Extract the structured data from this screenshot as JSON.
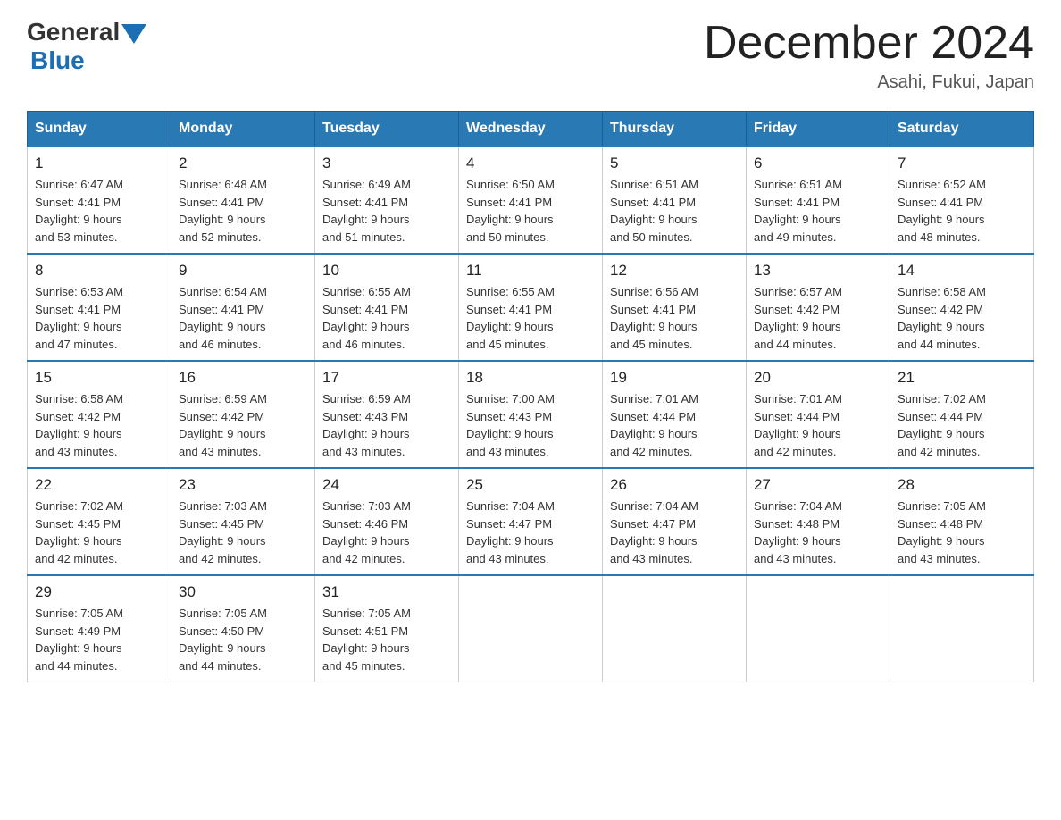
{
  "logo": {
    "general": "General",
    "blue": "Blue"
  },
  "title": "December 2024",
  "location": "Asahi, Fukui, Japan",
  "days_of_week": [
    "Sunday",
    "Monday",
    "Tuesday",
    "Wednesday",
    "Thursday",
    "Friday",
    "Saturday"
  ],
  "weeks": [
    [
      {
        "day": "1",
        "sunrise": "6:47 AM",
        "sunset": "4:41 PM",
        "daylight": "9 hours and 53 minutes."
      },
      {
        "day": "2",
        "sunrise": "6:48 AM",
        "sunset": "4:41 PM",
        "daylight": "9 hours and 52 minutes."
      },
      {
        "day": "3",
        "sunrise": "6:49 AM",
        "sunset": "4:41 PM",
        "daylight": "9 hours and 51 minutes."
      },
      {
        "day": "4",
        "sunrise": "6:50 AM",
        "sunset": "4:41 PM",
        "daylight": "9 hours and 50 minutes."
      },
      {
        "day": "5",
        "sunrise": "6:51 AM",
        "sunset": "4:41 PM",
        "daylight": "9 hours and 50 minutes."
      },
      {
        "day": "6",
        "sunrise": "6:51 AM",
        "sunset": "4:41 PM",
        "daylight": "9 hours and 49 minutes."
      },
      {
        "day": "7",
        "sunrise": "6:52 AM",
        "sunset": "4:41 PM",
        "daylight": "9 hours and 48 minutes."
      }
    ],
    [
      {
        "day": "8",
        "sunrise": "6:53 AM",
        "sunset": "4:41 PM",
        "daylight": "9 hours and 47 minutes."
      },
      {
        "day": "9",
        "sunrise": "6:54 AM",
        "sunset": "4:41 PM",
        "daylight": "9 hours and 46 minutes."
      },
      {
        "day": "10",
        "sunrise": "6:55 AM",
        "sunset": "4:41 PM",
        "daylight": "9 hours and 46 minutes."
      },
      {
        "day": "11",
        "sunrise": "6:55 AM",
        "sunset": "4:41 PM",
        "daylight": "9 hours and 45 minutes."
      },
      {
        "day": "12",
        "sunrise": "6:56 AM",
        "sunset": "4:41 PM",
        "daylight": "9 hours and 45 minutes."
      },
      {
        "day": "13",
        "sunrise": "6:57 AM",
        "sunset": "4:42 PM",
        "daylight": "9 hours and 44 minutes."
      },
      {
        "day": "14",
        "sunrise": "6:58 AM",
        "sunset": "4:42 PM",
        "daylight": "9 hours and 44 minutes."
      }
    ],
    [
      {
        "day": "15",
        "sunrise": "6:58 AM",
        "sunset": "4:42 PM",
        "daylight": "9 hours and 43 minutes."
      },
      {
        "day": "16",
        "sunrise": "6:59 AM",
        "sunset": "4:42 PM",
        "daylight": "9 hours and 43 minutes."
      },
      {
        "day": "17",
        "sunrise": "6:59 AM",
        "sunset": "4:43 PM",
        "daylight": "9 hours and 43 minutes."
      },
      {
        "day": "18",
        "sunrise": "7:00 AM",
        "sunset": "4:43 PM",
        "daylight": "9 hours and 43 minutes."
      },
      {
        "day": "19",
        "sunrise": "7:01 AM",
        "sunset": "4:44 PM",
        "daylight": "9 hours and 42 minutes."
      },
      {
        "day": "20",
        "sunrise": "7:01 AM",
        "sunset": "4:44 PM",
        "daylight": "9 hours and 42 minutes."
      },
      {
        "day": "21",
        "sunrise": "7:02 AM",
        "sunset": "4:44 PM",
        "daylight": "9 hours and 42 minutes."
      }
    ],
    [
      {
        "day": "22",
        "sunrise": "7:02 AM",
        "sunset": "4:45 PM",
        "daylight": "9 hours and 42 minutes."
      },
      {
        "day": "23",
        "sunrise": "7:03 AM",
        "sunset": "4:45 PM",
        "daylight": "9 hours and 42 minutes."
      },
      {
        "day": "24",
        "sunrise": "7:03 AM",
        "sunset": "4:46 PM",
        "daylight": "9 hours and 42 minutes."
      },
      {
        "day": "25",
        "sunrise": "7:04 AM",
        "sunset": "4:47 PM",
        "daylight": "9 hours and 43 minutes."
      },
      {
        "day": "26",
        "sunrise": "7:04 AM",
        "sunset": "4:47 PM",
        "daylight": "9 hours and 43 minutes."
      },
      {
        "day": "27",
        "sunrise": "7:04 AM",
        "sunset": "4:48 PM",
        "daylight": "9 hours and 43 minutes."
      },
      {
        "day": "28",
        "sunrise": "7:05 AM",
        "sunset": "4:48 PM",
        "daylight": "9 hours and 43 minutes."
      }
    ],
    [
      {
        "day": "29",
        "sunrise": "7:05 AM",
        "sunset": "4:49 PM",
        "daylight": "9 hours and 44 minutes."
      },
      {
        "day": "30",
        "sunrise": "7:05 AM",
        "sunset": "4:50 PM",
        "daylight": "9 hours and 44 minutes."
      },
      {
        "day": "31",
        "sunrise": "7:05 AM",
        "sunset": "4:51 PM",
        "daylight": "9 hours and 45 minutes."
      },
      null,
      null,
      null,
      null
    ]
  ],
  "labels": {
    "sunrise": "Sunrise:",
    "sunset": "Sunset:",
    "daylight": "Daylight:"
  }
}
